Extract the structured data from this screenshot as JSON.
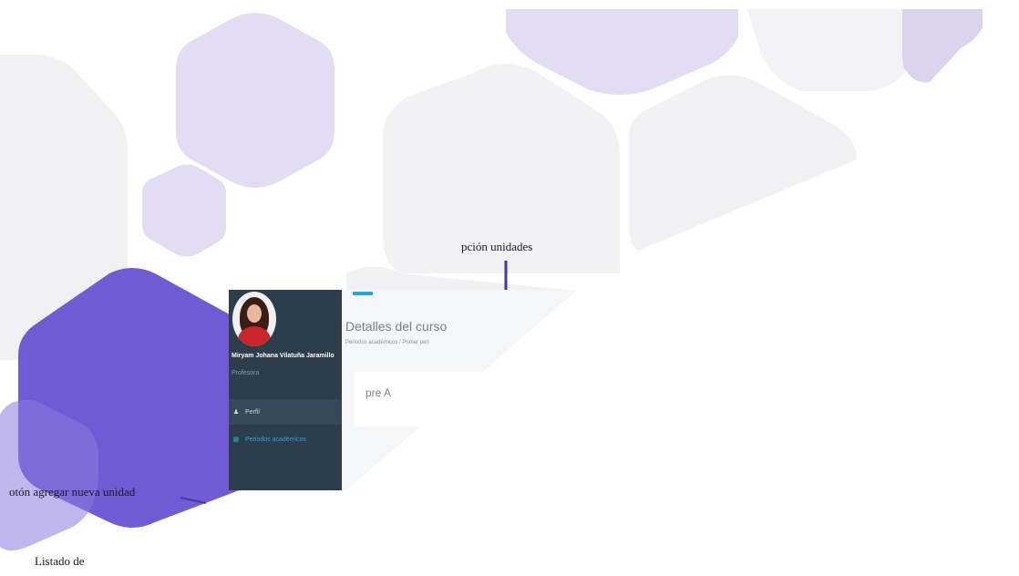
{
  "sidebar": {
    "user_name": "Miryam Johana Vilatuña Jaramillo",
    "user_role": "Profesora",
    "items": [
      {
        "label": "Perfil",
        "icon": "user-icon"
      },
      {
        "label": "Periodos académicos",
        "icon": "calendar-icon"
      }
    ]
  },
  "main": {
    "title": "Detalles del curso",
    "breadcrumb": "Periodos académicos  /  Primer peri",
    "card_text": "pre A"
  },
  "annotations": {
    "top": "pción unidades",
    "left": "otón agregar nueva unidad",
    "bottom": "Listado de"
  },
  "colors": {
    "sidebar_bg": "#2c3e4c",
    "accent": "#22a9d9",
    "hex_light": "#e2dcf2",
    "hex_dark": "#6f5bd4",
    "pointer_line": "#4535a8"
  }
}
